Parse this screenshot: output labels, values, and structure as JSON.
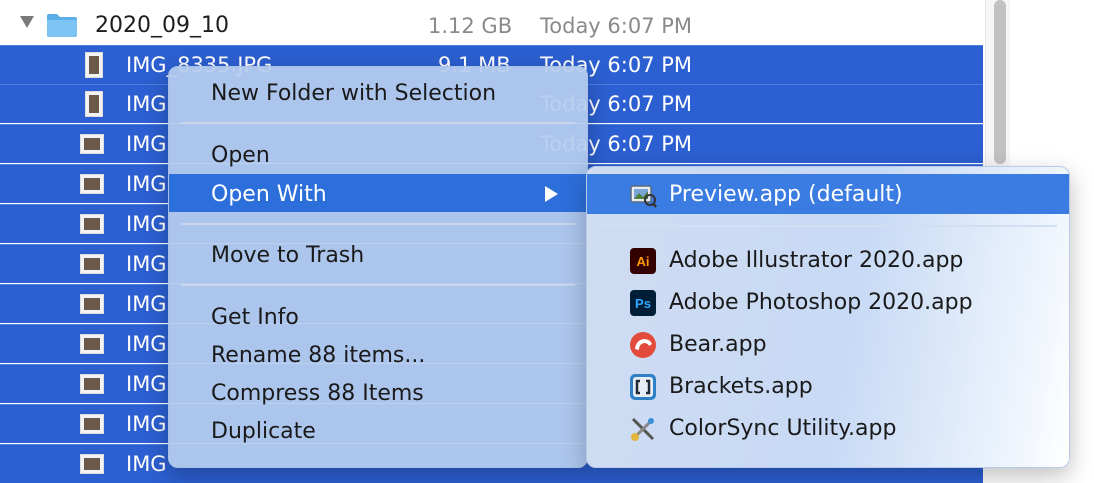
{
  "folder": {
    "name": "2020_09_10",
    "size": "1.12 GB",
    "date": "Today 6:07 PM"
  },
  "files": [
    {
      "name": "IMG_8335.JPG",
      "size": "9.1 MB",
      "date": "Today 6:07 PM"
    },
    {
      "name": "IMG",
      "size": "",
      "date": "Today 6:07 PM"
    },
    {
      "name": "IMG",
      "size": "",
      "date": "Today 6:07 PM"
    },
    {
      "name": "IMG",
      "size": "",
      "date": ""
    },
    {
      "name": "IMG",
      "size": "",
      "date": ""
    },
    {
      "name": "IMG",
      "size": "",
      "date": ""
    },
    {
      "name": "IMG",
      "size": "",
      "date": ""
    },
    {
      "name": "IMG",
      "size": "",
      "date": ""
    },
    {
      "name": "IMG",
      "size": "",
      "date": ""
    },
    {
      "name": "IMG",
      "size": "",
      "date": ""
    },
    {
      "name": "IMG",
      "size": "",
      "date": ""
    }
  ],
  "context_menu": {
    "new_folder": "New Folder with Selection",
    "open": "Open",
    "open_with": "Open With",
    "move_to_trash": "Move to Trash",
    "get_info": "Get Info",
    "rename": "Rename 88 items...",
    "compress": "Compress 88 Items",
    "duplicate": "Duplicate"
  },
  "open_with_submenu": {
    "default_app": "Preview.app (default)",
    "apps": [
      {
        "label": "Adobe Illustrator 2020.app",
        "icon": "illustrator-icon"
      },
      {
        "label": "Adobe Photoshop 2020.app",
        "icon": "photoshop-icon"
      },
      {
        "label": "Bear.app",
        "icon": "bear-icon"
      },
      {
        "label": "Brackets.app",
        "icon": "brackets-icon"
      },
      {
        "label": "ColorSync Utility.app",
        "icon": "colorsync-icon"
      }
    ]
  },
  "colors": {
    "selection_blue": "#2c5fd1",
    "menu_highlight": "#2c6fdb"
  }
}
